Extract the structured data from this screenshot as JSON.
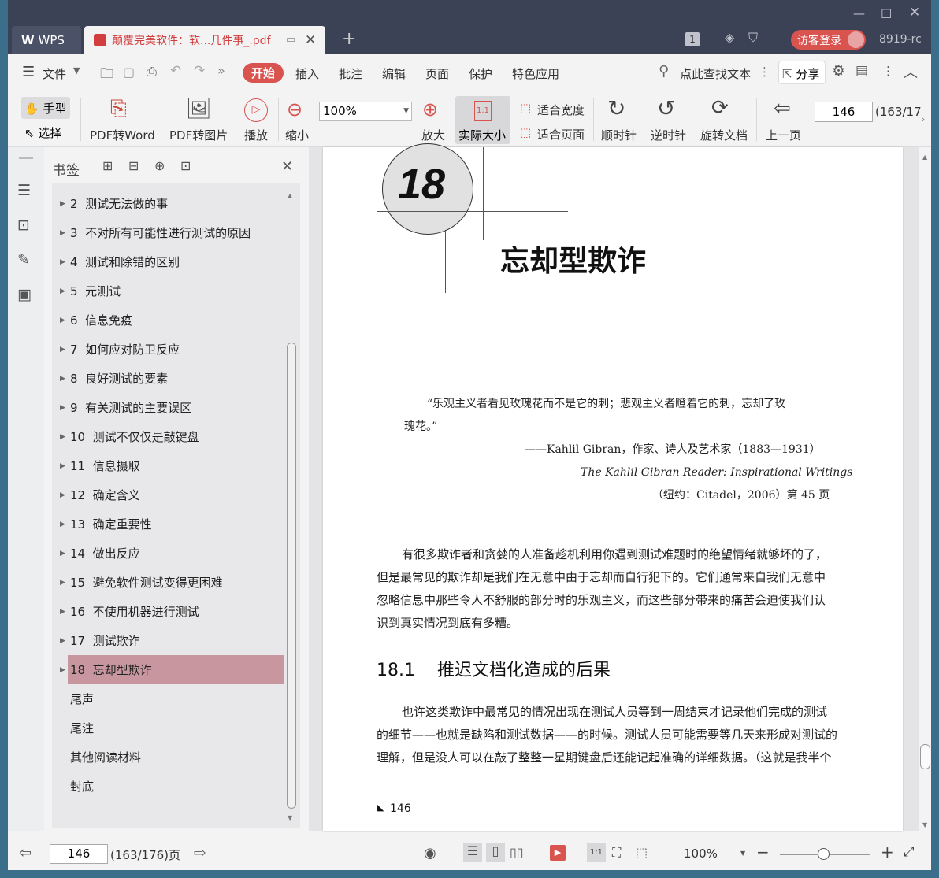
{
  "tabs": {
    "wps": "WPS",
    "doc": "颠覆完美软件：软...几件事_.pdf"
  },
  "titlebar": {
    "badge": "1",
    "login": "访客登录",
    "user": "8919-rc"
  },
  "menu": {
    "file": "文件",
    "items": [
      "开始",
      "插入",
      "批注",
      "编辑",
      "页面",
      "保护",
      "特色应用"
    ],
    "search": "点此查找文本",
    "share": "分享"
  },
  "toolbar": {
    "hand": "手型",
    "select": "选择",
    "pdf2word": "PDF转Word",
    "pdf2img": "PDF转图片",
    "play": "播放",
    "zoomout": "缩小",
    "zoom": "100%",
    "zoomin": "放大",
    "actual": "实际大小",
    "fitwidth": "适合宽度",
    "fitpage": "适合页面",
    "cw": "顺时针",
    "ccw": "逆时针",
    "rotate": "旋转文档",
    "prev": "上一页",
    "page": "146",
    "pagecount": "(163/17"
  },
  "bookmarks": {
    "title": "书签",
    "items": [
      {
        "label": "2  测试无法做的事",
        "arrow": true
      },
      {
        "label": "3  不对所有可能性进行测试的原因",
        "arrow": true
      },
      {
        "label": "4  测试和除错的区别",
        "arrow": true
      },
      {
        "label": "5  元测试",
        "arrow": true
      },
      {
        "label": "6  信息免疫",
        "arrow": true
      },
      {
        "label": "7  如何应对防卫反应",
        "arrow": true
      },
      {
        "label": "8  良好测试的要素",
        "arrow": true
      },
      {
        "label": "9  有关测试的主要误区",
        "arrow": true
      },
      {
        "label": "10  测试不仅仅是敲键盘",
        "arrow": true
      },
      {
        "label": "11  信息摄取",
        "arrow": true
      },
      {
        "label": "12  确定含义",
        "arrow": true
      },
      {
        "label": "13  确定重要性",
        "arrow": true
      },
      {
        "label": "14  做出反应",
        "arrow": true
      },
      {
        "label": "15  避免软件测试变得更困难",
        "arrow": true
      },
      {
        "label": "16  不使用机器进行测试",
        "arrow": true
      },
      {
        "label": "17  测试欺诈",
        "arrow": true
      },
      {
        "label": "18  忘却型欺诈",
        "arrow": true,
        "selected": true
      },
      {
        "label": "尾声",
        "arrow": false
      },
      {
        "label": "尾注",
        "arrow": false
      },
      {
        "label": "其他阅读材料",
        "arrow": false
      },
      {
        "label": "封底",
        "arrow": false
      }
    ]
  },
  "page": {
    "chapter_num": "18",
    "chapter_title": "忘却型欺诈",
    "quote_line1": "“乐观主义者看见玫瑰花而不是它的刺；悲观主义者瞪着它的刺，忘却了玫",
    "quote_line2": "瑰花。”",
    "quote_author": "——Kahlil Gibran，作家、诗人及艺术家（1883—1931）",
    "quote_book": "The Kahlil Gibran Reader: Inspirational Writings",
    "quote_pub": "（纽约：Citadel，2006）第 45 页",
    "para1": [
      "有很多欺诈者和贪婪的人准备趁机利用你遇到测试难题时的绝望情绪就够坏的了，",
      "但是最常见的欺诈却是我们在无意中由于忘却而自行犯下的。它们通常来自我们无意中",
      "忽略信息中那些令人不舒服的部分时的乐观主义，而这些部分带来的痛苦会迫使我们认",
      "识到真实情况到底有多糟。"
    ],
    "section": "18.1    推迟文档化造成的后果",
    "para2": [
      "也许这类欺诈中最常见的情况出现在测试人员等到一周结束才记录他们完成的测试",
      "的细节——也就是缺陷和测试数据——的时候。测试人员可能需要等几天来形成对测试的",
      "理解，但是没人可以在敲了整整一星期键盘后还能记起准确的详细数据。（这就是我半个"
    ],
    "footer": "146"
  },
  "status": {
    "page": "146",
    "count": "(163/176)页",
    "zoom": "100%"
  }
}
